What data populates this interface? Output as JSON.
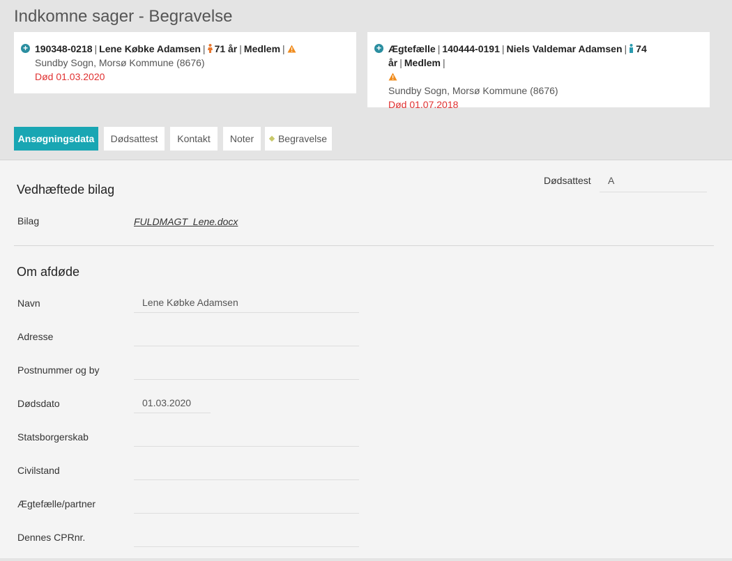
{
  "page_title": "Indkomne sager - Begravelse",
  "card1": {
    "cpr": "190348-0218",
    "name": "Lene Købke Adamsen",
    "age": "71 år",
    "membership": "Medlem",
    "location": "Sundby Sogn, Morsø Kommune (8676)",
    "death": "Død 01.03.2020"
  },
  "card2": {
    "relation": "Ægtefælle",
    "cpr": "140444-0191",
    "name": "Niels Valdemar Adamsen",
    "age": "74 år",
    "membership": "Medlem",
    "location": "Sundby Sogn, Morsø Kommune (8676)",
    "death": "Død 01.07.2018"
  },
  "tabs": [
    "Ansøgningsdata",
    "Dødsattest",
    "Kontakt",
    "Noter",
    "Begravelse"
  ],
  "doedsattest": {
    "label": "Dødsattest",
    "value": "A"
  },
  "attachments": {
    "title": "Vedhæftede bilag",
    "label": "Bilag",
    "file": "FULDMAGT_Lene.docx"
  },
  "deceased": {
    "title": "Om afdøde",
    "fields": [
      {
        "label": "Navn",
        "value": "Lene Købke Adamsen"
      },
      {
        "label": "Adresse",
        "value": ""
      },
      {
        "label": "Postnummer og by",
        "value": ""
      },
      {
        "label": "Dødsdato",
        "value": "01.03.2020"
      },
      {
        "label": "Statsborgerskab",
        "value": ""
      },
      {
        "label": "Civilstand",
        "value": ""
      },
      {
        "label": "Ægtefælle/partner",
        "value": ""
      },
      {
        "label": "Dennes CPRnr.",
        "value": ""
      }
    ]
  },
  "colors": {
    "accent": "#19a6b3",
    "death": "#e03030",
    "warning": "#f08c1e",
    "female": "#e8772e",
    "male": "#2a9bb0"
  },
  "icons": [
    "plus-circle-icon",
    "female-person-icon",
    "male-person-icon",
    "warning-icon",
    "diamond-icon"
  ]
}
